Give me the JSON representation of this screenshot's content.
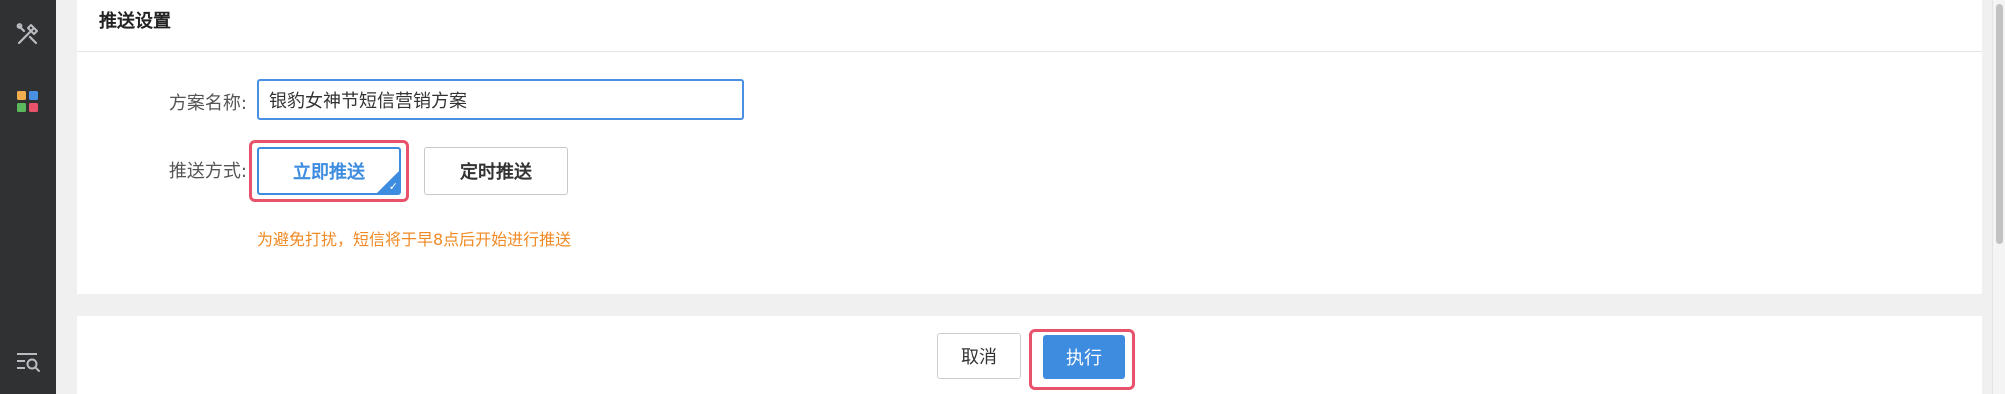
{
  "card": {
    "title": "推送设置"
  },
  "form": {
    "name_label": "方案名称:",
    "name_value": "银豹女神节短信营销方案",
    "push_label": "推送方式:",
    "push_options": [
      {
        "label": "立即推送",
        "selected": true
      },
      {
        "label": "定时推送",
        "selected": false
      }
    ],
    "hint": "为避免打扰，短信将于早8点后开始进行推送"
  },
  "actions": {
    "cancel_label": "取消",
    "execute_label": "执行"
  },
  "colors": {
    "accent": "#3d8ce0",
    "hint": "#f08a24",
    "highlight": "#e8526a",
    "sidebar": "#2f3133"
  },
  "icons": {
    "sidebar": [
      "tools-icon",
      "apps-grid-icon",
      "list-search-icon"
    ],
    "selected_option": "checkmark-icon"
  }
}
